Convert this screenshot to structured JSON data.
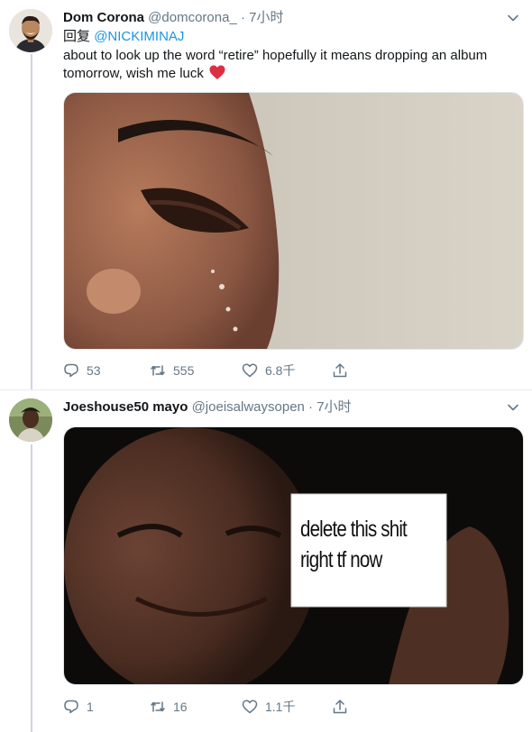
{
  "tweets": [
    {
      "display_name": "Dom Corona",
      "handle": "@domcorona_",
      "separator": "·",
      "time": "7小时",
      "reply_prefix": "回复",
      "reply_to": "@NICKIMINAJ",
      "text": "about to look up the word “retire” hopefully it means dropping an album tomorrow, wish me luck",
      "actions": {
        "replies": "53",
        "retweets": "555",
        "likes": "6.8千"
      }
    },
    {
      "display_name": "Joeshouse50 mayo",
      "handle": "@joeisalwaysopen",
      "separator": "·",
      "time": "7小时",
      "media_sign_lines": [
        "delete this shit",
        "right tf now"
      ],
      "actions": {
        "replies": "1",
        "retweets": "16",
        "likes": "1.1千"
      }
    }
  ],
  "colors": {
    "link": "#1b95e0",
    "secondary_text": "#657786",
    "heart": "#e0245e",
    "thread_line": "#ccd6dd"
  },
  "icons": [
    "chevron-down-icon",
    "reply-icon",
    "retweet-icon",
    "like-icon",
    "share-icon",
    "heart-emoji"
  ]
}
